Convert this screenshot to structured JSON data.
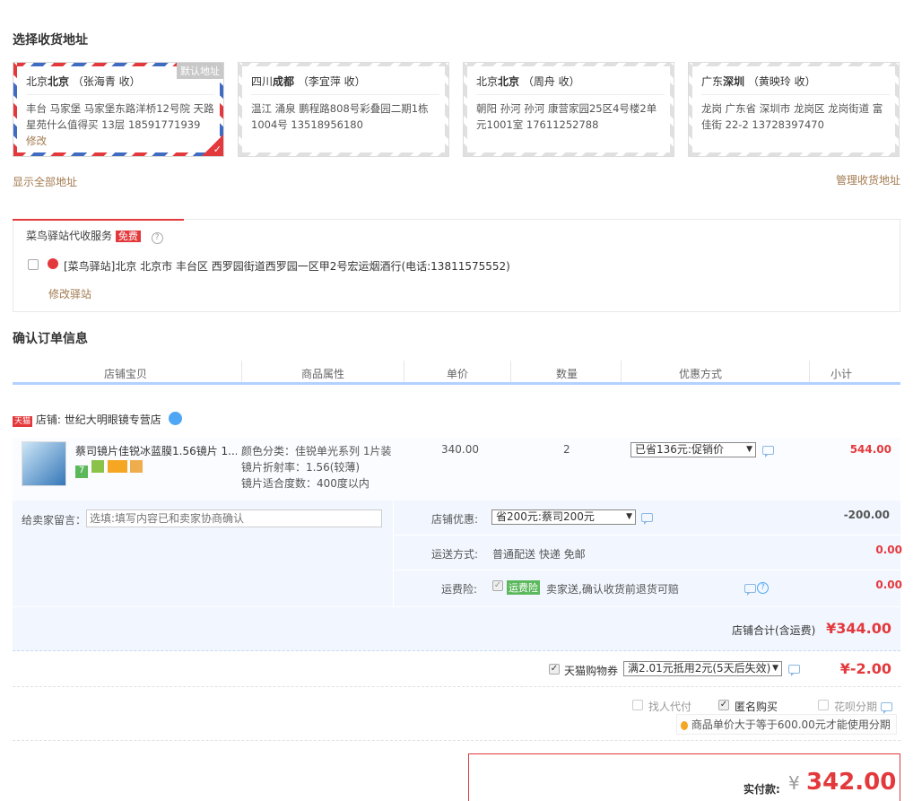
{
  "address_section": {
    "title": "选择收货地址",
    "default_tag": "默认地址",
    "edit_link": "修改",
    "show_all": "显示全部地址",
    "manage": "管理收货地址",
    "cards": [
      {
        "city": "北京",
        "district": "北京",
        "name": "（张海青 收）",
        "detail": "丰台 马家堡  马家堡东路洋桥12号院 天路星苑什么值得买 13层 18591771939"
      },
      {
        "city": "四川",
        "district": "成都",
        "name": "（李宜萍 收）",
        "detail": "温江 涌泉 鹏程路808号彩叠园二期1栋1004号 13518956180"
      },
      {
        "city": "北京",
        "district": "北京",
        "name": "（周舟 收）",
        "detail": "朝阳 孙河 孙河 康营家园25区4号楼2单元1001室 17611252788"
      },
      {
        "city": "广东",
        "district": "深圳",
        "name": "（黄映玲 收）",
        "detail": "龙岗 广东省 深圳市 龙岗区 龙岗街道 富佳街 22-2 13728397470"
      }
    ]
  },
  "cainiao": {
    "title": "菜鸟驿站代收服务",
    "free": "免费",
    "help": "?",
    "station": "[菜鸟驿站]北京 北京市 丰台区 西罗园街道西罗园一区甲2号宏运烟酒行(电话:13811575552)",
    "modify": "修改驿站"
  },
  "order": {
    "title": "确认订单信息",
    "columns": [
      "店铺宝贝",
      "商品属性",
      "单价",
      "数量",
      "优惠方式",
      "小计"
    ],
    "shop_tag": "天猫",
    "shop_name": "店铺: 世纪大明眼镜专营店",
    "item": {
      "name": "蔡司镜片佳锐冰蓝膜1.56镜片 1...",
      "attr1": "颜色分类：佳锐单光系列 1片装",
      "attr2": "镜片折射率：1.56(较薄)",
      "attr3": "镜片适合度数：400度以内",
      "price": "340.00",
      "qty": "2",
      "discount": "已省136元:促销价",
      "subtotal": "544.00"
    },
    "message_label": "给卖家留言：",
    "message_placeholder": "选填:填写内容已和卖家协商确认",
    "shop_discount_label": "店铺优惠:",
    "shop_discount_value": "省200元:蔡司200元",
    "shop_discount_amount": "-200.00",
    "shipping_label": "运送方式:",
    "shipping_value": "普通配送 快递 免邮",
    "shipping_amount": "0.00",
    "insurance_label": "运费险:",
    "insurance_tag": "运费险",
    "insurance_desc": "卖家送,确认收货前退货可赔",
    "insurance_amount": "0.00",
    "shop_total_label": "店铺合计(含运费)",
    "shop_total": "¥344.00"
  },
  "coupon": {
    "label": "天猫购物券",
    "value": "满2.01元抵用2元(5天后失效)",
    "amount": "¥-2.00"
  },
  "options": {
    "pay_for_me": "找人代付",
    "anonymous": "匿名购买",
    "installment": "花呗分期",
    "installment_tip": "商品单价大于等于600.00元才能使用分期"
  },
  "final": {
    "label": "实付款:",
    "currency": "¥",
    "amount": "342.00"
  },
  "colors": {
    "accent_red": "#e4393c",
    "header_blue": "#b2d1ff",
    "link_brown": "#a37b50"
  }
}
